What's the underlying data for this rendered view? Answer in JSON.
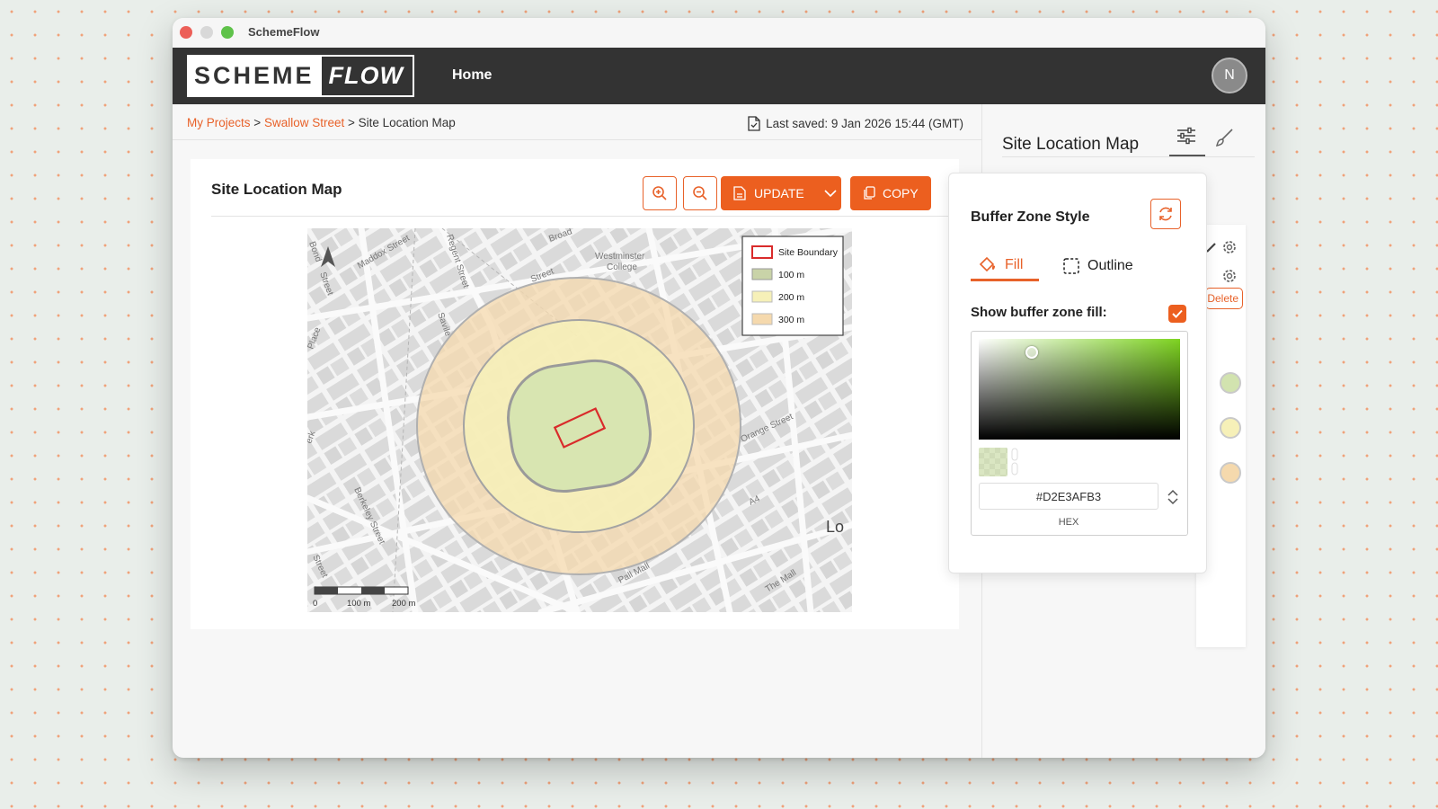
{
  "window": {
    "title": "SchemeFlow"
  },
  "appbar": {
    "logo_left": "SCHEME",
    "logo_right": "FLOW",
    "nav_home": "Home",
    "avatar_initial": "N"
  },
  "breadcrumb": {
    "items": [
      "My Projects",
      "Swallow Street",
      "Site Location Map"
    ],
    "separator": ">"
  },
  "saved": {
    "text": "Last saved: 9 Jan 2026 15:44 (GMT)",
    "icon": "document-check-icon"
  },
  "card": {
    "title": "Site Location Map",
    "zoom_in_icon": "zoom-in-icon",
    "zoom_out_icon": "zoom-out-icon",
    "update_label": "UPDATE",
    "copy_label": "COPY"
  },
  "map": {
    "street_labels": [
      "Maddox Street",
      "Regent Street",
      "Broad",
      "Westminster",
      "College",
      "Street",
      "Savile",
      "Orange Street",
      "A4",
      "Lo",
      "Pall Mall",
      "The Mall",
      "Berkeley Street",
      "Place",
      "Bond",
      "Street",
      "Street",
      "erk"
    ],
    "legend": [
      {
        "label": "Site Boundary",
        "color": "#d92b2b",
        "style": "outline"
      },
      {
        "label": "100 m",
        "color": "#c9d3a8",
        "style": "fill"
      },
      {
        "label": "200 m",
        "color": "#f6f0b8",
        "style": "fill"
      },
      {
        "label": "300 m",
        "color": "#f5d9ad",
        "style": "fill"
      }
    ],
    "scale": {
      "labels": [
        "0",
        "100 m",
        "200 m"
      ]
    }
  },
  "right_panel": {
    "title": "Site Location Map",
    "settings_icon": "sliders-icon",
    "style_icon": "brush-icon",
    "delete_label": "Delete"
  },
  "popover": {
    "title": "Buffer Zone Style",
    "reset_icon": "reset-icon",
    "tabs": [
      {
        "label": "Fill",
        "icon": "paint-bucket-icon",
        "active": true
      },
      {
        "label": "Outline",
        "icon": "dashed-square-icon",
        "active": false
      }
    ],
    "show_fill_label": "Show buffer zone fill:",
    "show_fill_checked": true,
    "hex_value": "#D2E3AFB3",
    "hex_label": "HEX"
  },
  "colors": {
    "accent": "#ec5f1f",
    "appbar": "#333333",
    "fill_preview": "#D2E3AFB3"
  }
}
